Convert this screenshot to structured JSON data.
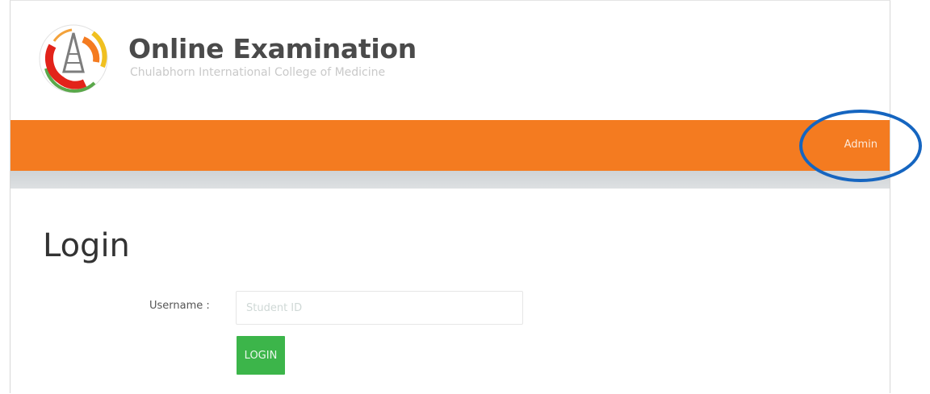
{
  "header": {
    "site_title": "Online Examination",
    "site_subtitle": "Chulabhorn International College of Medicine",
    "logo_icon": "college-seal-logo"
  },
  "navbar": {
    "admin_label": "Admin",
    "background_color": "#f47b20"
  },
  "login": {
    "page_title": "Login",
    "username_label": "Username :",
    "username_placeholder": "Student ID",
    "username_value": "",
    "login_button_label": "LOGIN",
    "login_button_color": "#3cb54a"
  },
  "annotation": {
    "highlight_color": "#1565c0"
  }
}
